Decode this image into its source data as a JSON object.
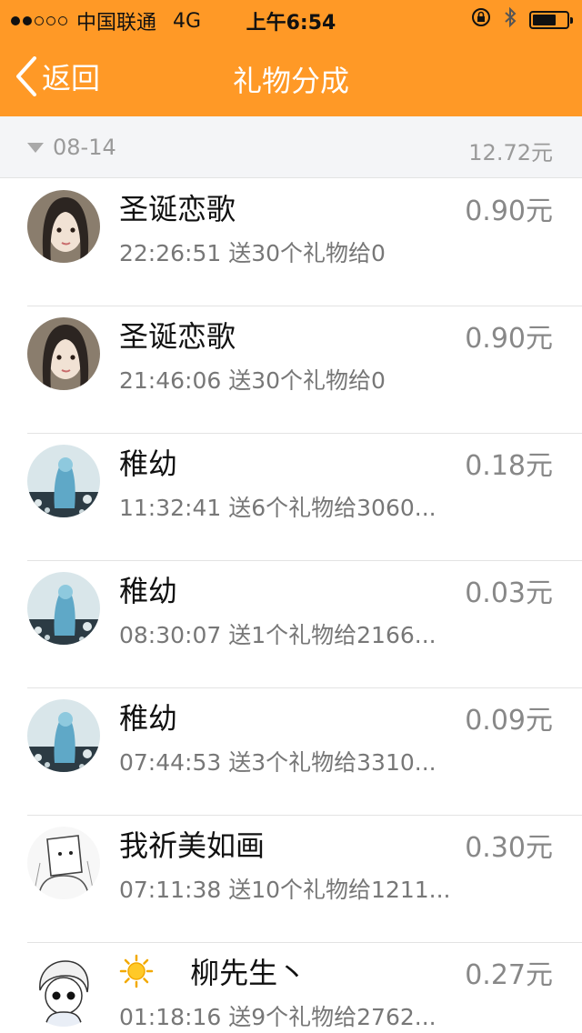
{
  "status_bar": {
    "carrier": "中国联通",
    "network": "4G",
    "time": "上午6:54"
  },
  "nav": {
    "back_label": "返回",
    "title": "礼物分成"
  },
  "section": {
    "date": "08-14",
    "total": "12.72元"
  },
  "records": [
    {
      "name": "圣诞恋歌",
      "detail": "22:26:51 送30个礼物给0",
      "amount": "0.90元",
      "avatar": "girl-avatar"
    },
    {
      "name": "圣诞恋歌",
      "detail": "21:46:06 送30个礼物给0",
      "amount": "0.90元",
      "avatar": "girl-avatar"
    },
    {
      "name": "稚幼",
      "detail": "11:32:41 送6个礼物给3060...",
      "amount": "0.18元",
      "avatar": "blue-art-avatar"
    },
    {
      "name": "稚幼",
      "detail": "08:30:07 送1个礼物给2166...",
      "amount": "0.03元",
      "avatar": "blue-art-avatar"
    },
    {
      "name": "稚幼",
      "detail": "07:44:53 送3个礼物给3310...",
      "amount": "0.09元",
      "avatar": "blue-art-avatar"
    },
    {
      "name": "我祈美如画",
      "detail": "07:11:38 送10个礼物给1211...",
      "amount": "0.30元",
      "avatar": "sketch-avatar"
    },
    {
      "name": "柳先生丶",
      "detail": "01:18:16 送9个礼物给2762...",
      "amount": "0.27元",
      "avatar": "anime-boy-avatar",
      "name_icon": "sun-icon"
    }
  ],
  "colors": {
    "accent": "#FF9926",
    "section_bg": "#F4F5F7",
    "secondary_text": "#777777"
  }
}
